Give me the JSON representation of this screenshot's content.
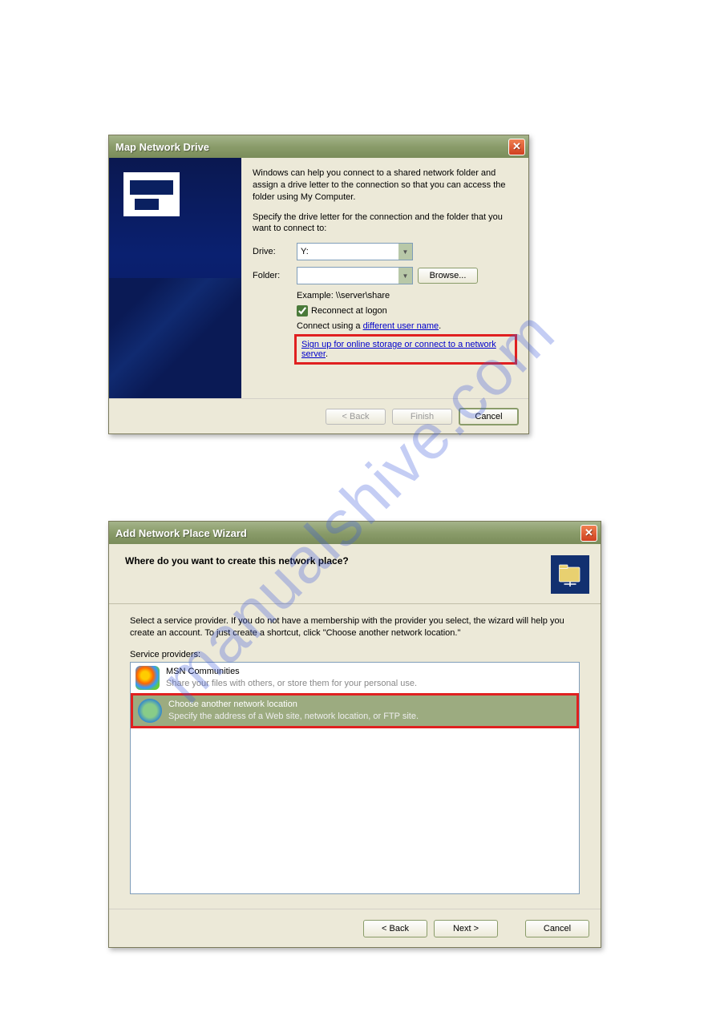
{
  "watermark": "manualshive.com",
  "dialog1": {
    "title": "Map Network Drive",
    "intro": "Windows can help you connect to a shared network folder and assign a drive letter to the connection so that you can access the folder using My Computer.",
    "specify": "Specify the drive letter for the connection and the folder that you want to connect to:",
    "drive_label": "Drive:",
    "drive_value": "Y:",
    "folder_label": "Folder:",
    "folder_value": "",
    "browse_label": "Browse...",
    "example_label": "Example: \\\\server\\share",
    "reconnect_label": "Reconnect at logon",
    "connect_prefix": "Connect using a ",
    "connect_link": "different user name",
    "signup_link": "Sign up for online storage or connect to a network server",
    "back_label": "< Back",
    "finish_label": "Finish",
    "cancel_label": "Cancel"
  },
  "dialog2": {
    "title": "Add Network Place Wizard",
    "header_title": "Where do you want to create this network place?",
    "instructions": "Select a service provider.  If you do not have a membership with the provider you select, the wizard will help you create an account.  To just create a shortcut, click \"Choose another network location.\"",
    "list_label": "Service providers:",
    "items": [
      {
        "title": "MSN Communities",
        "sub": "Share your files with others, or store them for your personal use."
      },
      {
        "title": "Choose another network location",
        "sub": "Specify the address of a Web site, network location, or FTP site."
      }
    ],
    "back_label": "< Back",
    "next_label": "Next >",
    "cancel_label": "Cancel"
  }
}
